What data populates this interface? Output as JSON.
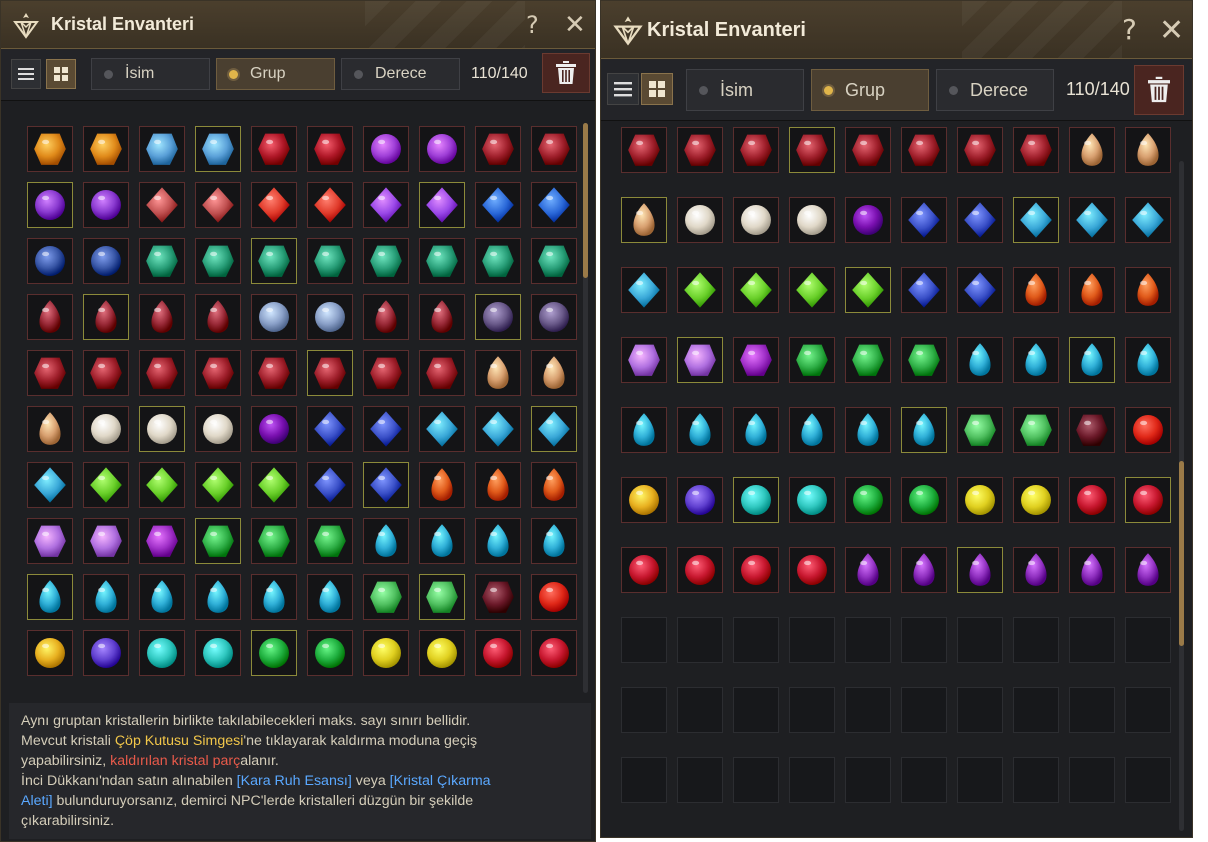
{
  "window_title": "Kristal Envanteri",
  "help_label": "?",
  "close_label": "✕",
  "sort_options": [
    {
      "label": "İsim",
      "selected": false
    },
    {
      "label": "Grup",
      "selected": true
    },
    {
      "label": "Derece",
      "selected": false
    }
  ],
  "capacity": "110/140",
  "info": {
    "l1": "Aynı gruptan kristallerin birlikte takılabilecekleri maks. sayı sınırı bellidir.",
    "l2a": "Mevcut kristali ",
    "l2b": "Çöp Kutusu Simgesi",
    "l2c": "'ne tıklayarak kaldırma moduna geçiş",
    "l3a": "yapabilirsiniz, ",
    "l3b": "kaldırılan kristal parç",
    "l3c": "alanır.",
    "l4a": "İnci Dükkanı'ndan satın alınabilen ",
    "l4b": "[Kara Ruh Esansı]",
    "l4c": " veya ",
    "l4d": "[Kristal Çıkarma",
    "l5a": "Aleti]",
    "l5b": " bulunduruyorsanız, demirci NPC'lerde kristalleri düzgün bir şekilde",
    "l6": "çıkarabilirsiniz."
  },
  "colors": {
    "accent": "#e0b54a",
    "info_highlight_yellow": "#f2c74a",
    "info_highlight_red": "#e85a4a",
    "info_highlight_blue": "#5aa8ff"
  },
  "left_grid_rows": [
    [
      "amber-flame",
      "amber-flame",
      "sky-ore",
      "sky-ore",
      "ruby",
      "ruby",
      "violet-orb",
      "violet-orb",
      "garnet-cluster",
      "garnet-cluster"
    ],
    [
      "amethyst-ring",
      "amethyst-ring",
      "rose-shard",
      "rose-shard",
      "red-shard",
      "red-shard",
      "violet-shard",
      "violet-shard",
      "sapphire",
      "sapphire"
    ],
    [
      "navy-gem",
      "navy-gem",
      "jade-disc",
      "jade-disc",
      "jade-disc",
      "jade-disc",
      "jade-disc",
      "jade-disc",
      "jade-disc",
      "jade-disc"
    ],
    [
      "blood-drop",
      "blood-drop",
      "blood-drop",
      "blood-drop",
      "silver-gem",
      "silver-gem",
      "blood-drop",
      "blood-drop",
      "dusk-gem",
      "dusk-gem"
    ],
    [
      "garnet-cluster",
      "garnet-cluster",
      "garnet-cluster",
      "garnet-cluster",
      "garnet-cluster",
      "garnet-cluster",
      "garnet-cluster",
      "garnet-cluster",
      "ember-drop",
      "ember-drop"
    ],
    [
      "ember-drop",
      "pearl",
      "pearl",
      "pearl",
      "void-orb",
      "star-sapphire",
      "star-sapphire",
      "ice-kite",
      "ice-kite",
      "ice-kite"
    ],
    [
      "ice-kite",
      "lime-kite",
      "lime-kite",
      "lime-kite",
      "lime-kite",
      "star-sapphire",
      "star-sapphire",
      "fire-drop",
      "fire-drop",
      "fire-drop"
    ],
    [
      "lilac-crystal",
      "lilac-crystal",
      "violet-flame",
      "emerald",
      "emerald",
      "emerald",
      "aqua-drop",
      "aqua-drop",
      "aqua-drop",
      "aqua-drop"
    ],
    [
      "aqua-drop",
      "aqua-drop",
      "aqua-drop",
      "aqua-drop",
      "aqua-drop",
      "aqua-drop",
      "green-crystal",
      "green-crystal",
      "dark-garnet",
      "red-orb"
    ],
    [
      "gold-gem",
      "indigo-gem",
      "teal-gem",
      "teal-gem",
      "green-gem",
      "green-gem",
      "yellow-gem",
      "yellow-gem",
      "red-gem",
      "red-gem"
    ]
  ],
  "right_grid_rows": [
    [
      "garnet-cluster",
      "garnet-cluster",
      "garnet-cluster",
      "garnet-cluster",
      "garnet-cluster",
      "garnet-cluster",
      "garnet-cluster",
      "garnet-cluster",
      "ember-drop",
      "ember-drop"
    ],
    [
      "ember-drop",
      "pearl",
      "pearl",
      "pearl",
      "void-orb",
      "star-sapphire",
      "star-sapphire",
      "ice-kite",
      "ice-kite",
      "ice-kite"
    ],
    [
      "ice-kite",
      "lime-kite",
      "lime-kite",
      "lime-kite",
      "lime-kite",
      "star-sapphire",
      "star-sapphire",
      "fire-drop",
      "fire-drop",
      "fire-drop"
    ],
    [
      "lilac-crystal",
      "lilac-crystal",
      "violet-flame",
      "emerald",
      "emerald",
      "emerald",
      "aqua-drop",
      "aqua-drop",
      "aqua-drop",
      "aqua-drop"
    ],
    [
      "aqua-drop",
      "aqua-drop",
      "aqua-drop",
      "aqua-drop",
      "aqua-drop",
      "aqua-drop",
      "green-crystal",
      "green-crystal",
      "dark-garnet",
      "red-orb"
    ],
    [
      "gold-gem",
      "indigo-gem",
      "teal-gem",
      "teal-gem",
      "green-gem",
      "green-gem",
      "yellow-gem",
      "yellow-gem",
      "red-gem",
      "red-gem"
    ],
    [
      "red-gem",
      "red-gem",
      "red-gem",
      "red-gem",
      "purple-drop",
      "purple-drop",
      "purple-drop",
      "purple-drop",
      "purple-drop",
      "purple-drop"
    ],
    [
      "",
      "",
      "",
      "",
      "",
      "",
      "",
      "",
      "",
      ""
    ],
    [
      "",
      "",
      "",
      "",
      "",
      "",
      "",
      "",
      "",
      ""
    ],
    [
      "",
      "",
      "",
      "",
      "",
      "",
      "",
      "",
      "",
      ""
    ]
  ],
  "gem_colors": {
    "amber-flame": "#e08a1a",
    "sky-ore": "#5aa0d8",
    "ruby": "#b01828",
    "violet-orb": "#a040d8",
    "garnet-cluster": "#a0202c",
    "amethyst-ring": "#8a3ad0",
    "rose-shard": "#c05050",
    "red-shard": "#e03a2a",
    "violet-shard": "#9a48e8",
    "sapphire": "#2a68d8",
    "navy-gem": "#3a58a8",
    "jade-disc": "#2aa07a",
    "blood-drop": "#9a2a38",
    "silver-gem": "#8aa0c8",
    "dusk-gem": "#6a5a8a",
    "ember-drop": "#d8a070",
    "pearl": "#e0d8c8",
    "void-orb": "#7a10b0",
    "star-sapphire": "#3a50c8",
    "ice-kite": "#3aa8d8",
    "lime-kite": "#6ad02a",
    "fire-drop": "#e05a1a",
    "lilac-crystal": "#b070e0",
    "violet-flame": "#a030c8",
    "emerald": "#30b048",
    "aqua-drop": "#30b0d8",
    "green-crystal": "#50c060",
    "dark-garnet": "#6a1828",
    "red-orb": "#e02818",
    "gold-gem": "#e8b020",
    "indigo-gem": "#6040d0",
    "teal-gem": "#30c8c0",
    "green-gem": "#20b040",
    "yellow-gem": "#e0d020",
    "red-gem": "#c81830",
    "purple-drop": "#9030c0"
  }
}
